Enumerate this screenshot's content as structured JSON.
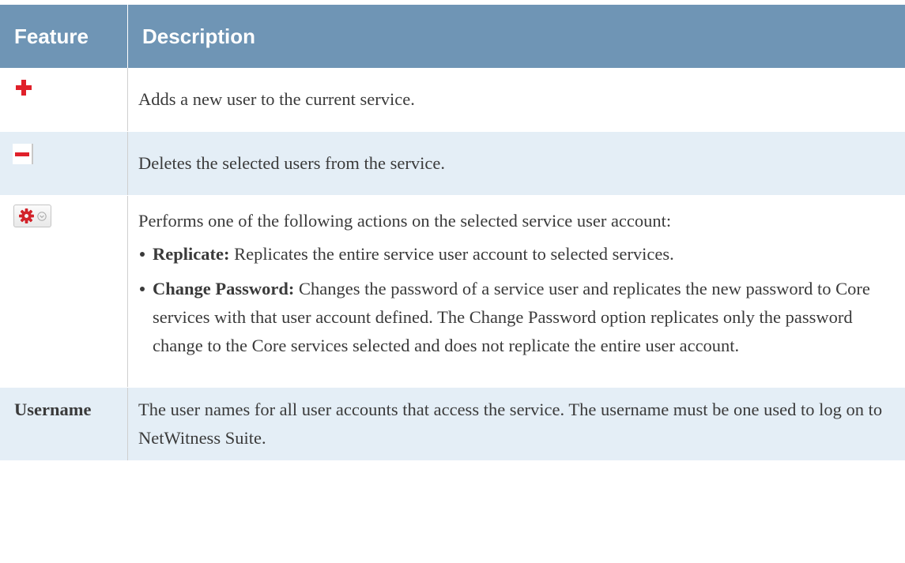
{
  "table": {
    "headers": {
      "feature": "Feature",
      "description": "Description"
    },
    "rows": {
      "add": {
        "icon": "plus-icon",
        "description": "Adds a new user to the current service."
      },
      "delete": {
        "icon": "minus-icon",
        "description": "Deletes the selected users from the service."
      },
      "actions": {
        "icon": "gear-icon",
        "description": "Performs one of the following actions on the selected service user account:",
        "options": [
          {
            "name": "Replicate:",
            "text": " Replicates the entire service user account to selected services."
          },
          {
            "name": "Change Password:",
            "text": " Changes the password of a service user and replicates the new password to Core services with that user account defined. The Change Password option replicates only the password change to the Core services selected and does not replicate the entire user account."
          }
        ]
      },
      "username": {
        "feature": "Username",
        "description": "The user names for all user accounts that access the service. The username must be one used to log on to NetWitness Suite."
      }
    }
  },
  "colors": {
    "header_bg": "#6f95b5",
    "header_text": "#ffffff",
    "alt_row_bg": "#e4eef6",
    "icon_red": "#e0202a",
    "body_text": "#3a3a3a"
  }
}
